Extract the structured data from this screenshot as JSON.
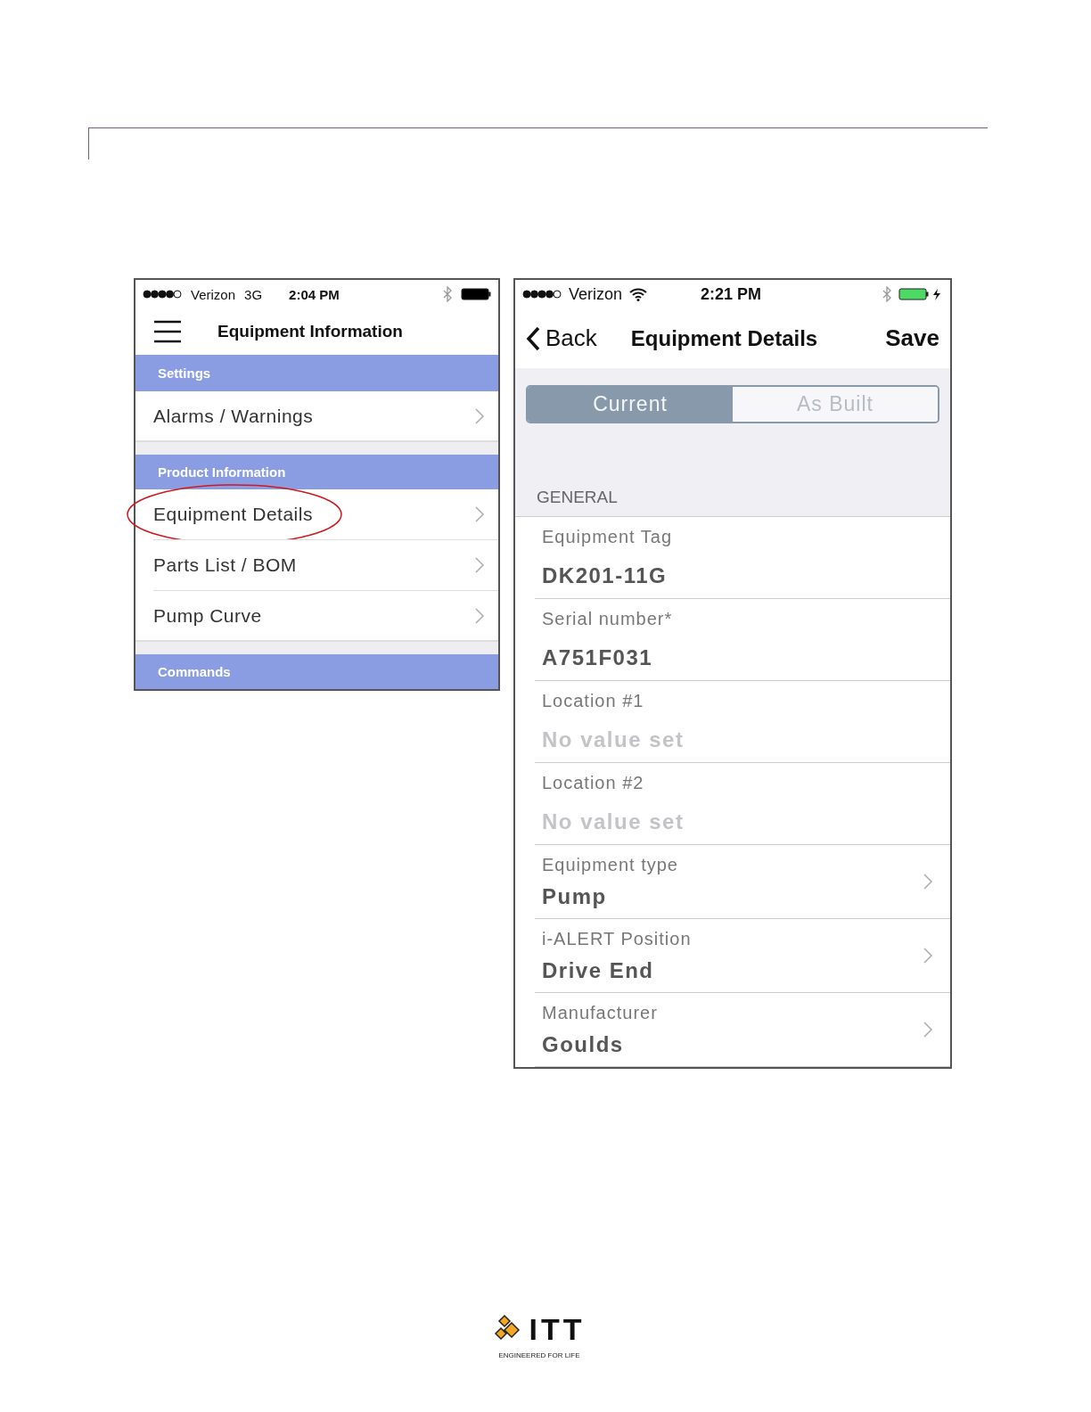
{
  "left_phone": {
    "status_bar": {
      "carrier": "Verizon",
      "network": "3G",
      "time": "2:04 PM",
      "charging": false
    },
    "title": "Equipment Information",
    "sections": [
      {
        "header": "Settings",
        "items": [
          {
            "label": "Alarms / Warnings",
            "circled": false
          }
        ]
      },
      {
        "header": "Product Information",
        "items": [
          {
            "label": "Equipment Details",
            "circled": true
          },
          {
            "label": "Parts List / BOM",
            "circled": false
          },
          {
            "label": "Pump Curve",
            "circled": false
          }
        ]
      },
      {
        "header": "Commands"
      }
    ]
  },
  "right_phone": {
    "status_bar": {
      "carrier": "Verizon",
      "time": "2:21 PM",
      "charging": true
    },
    "back": "Back",
    "title": "Equipment Details",
    "save": "Save",
    "segments": [
      {
        "label": "Current",
        "selected": true
      },
      {
        "label": "As Built",
        "selected": false
      }
    ],
    "group": "GENERAL",
    "fields": [
      {
        "kind": "text",
        "label": "Equipment Tag",
        "value": "DK201-11G"
      },
      {
        "kind": "text",
        "label": "Serial number*",
        "value": "A751F031"
      },
      {
        "kind": "text",
        "label": "Location #1",
        "placeholder": "No value set"
      },
      {
        "kind": "text",
        "label": "Location #2",
        "placeholder": "No value set"
      },
      {
        "kind": "picker",
        "label": "Equipment type",
        "value": "Pump"
      },
      {
        "kind": "picker",
        "label": "i-ALERT Position",
        "value": "Drive End"
      },
      {
        "kind": "picker",
        "label": "Manufacturer",
        "value": "Goulds"
      }
    ]
  },
  "footer": {
    "brand": "ITT",
    "tagline": "ENGINEERED FOR LIFE"
  }
}
